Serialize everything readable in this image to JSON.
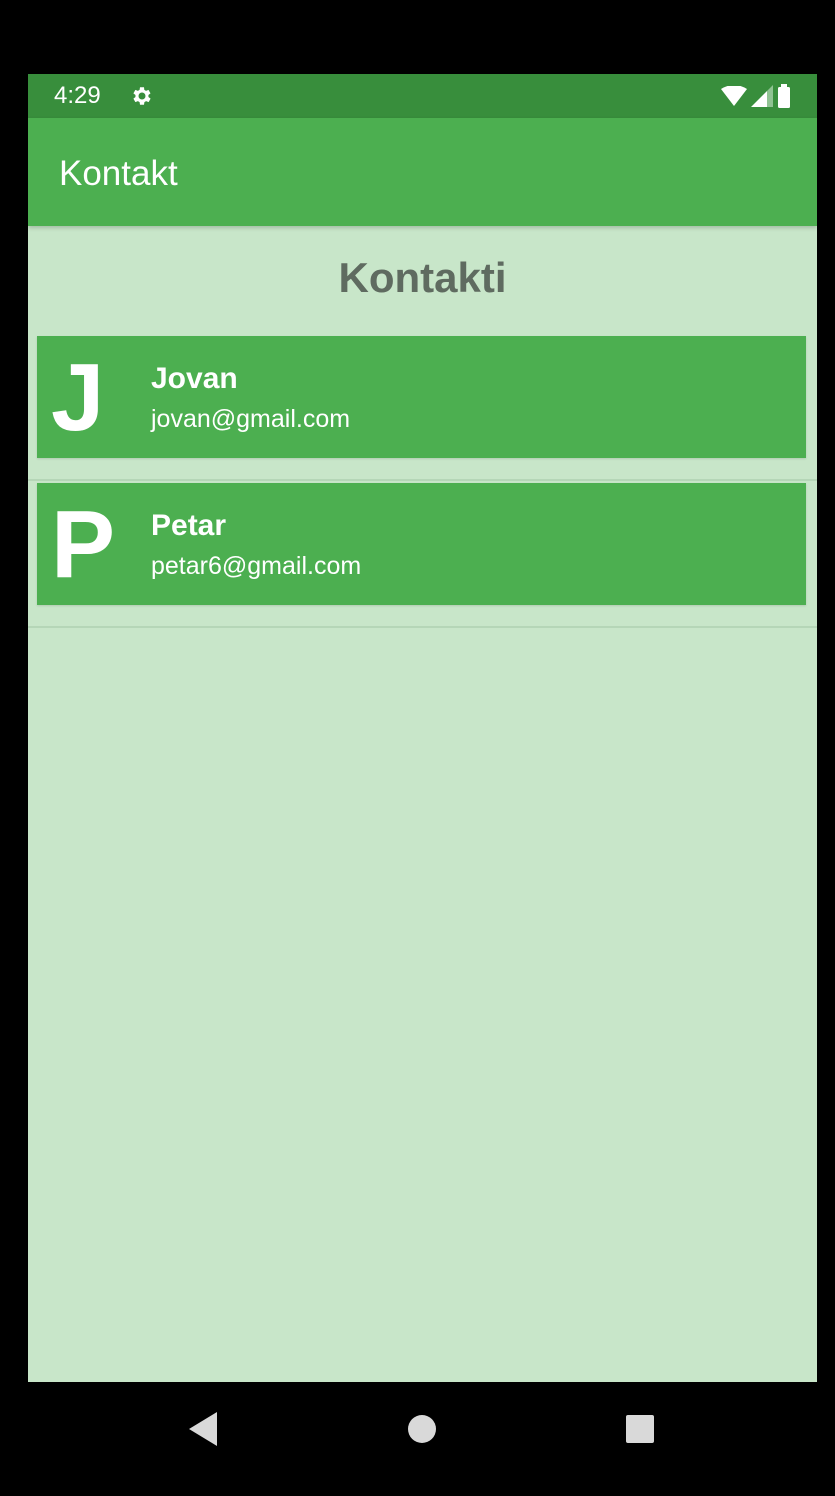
{
  "status_bar": {
    "time": "4:29",
    "icons": {
      "left": "gear-icon",
      "right": [
        "wifi-icon",
        "signal-icon",
        "battery-icon"
      ]
    },
    "bar_color": "#388e3c"
  },
  "app_bar": {
    "title": "Kontakt",
    "color": "#4caf50"
  },
  "main": {
    "heading": "Kontakti",
    "background_color": "#c8e6c9",
    "contacts": [
      {
        "initial": "J",
        "name": "Jovan",
        "email": "jovan@gmail.com"
      },
      {
        "initial": "P",
        "name": "Petar",
        "email": "petar6@gmail.com"
      }
    ]
  },
  "nav_bar": {
    "buttons": [
      "back-icon",
      "home-icon",
      "recents-icon"
    ]
  }
}
